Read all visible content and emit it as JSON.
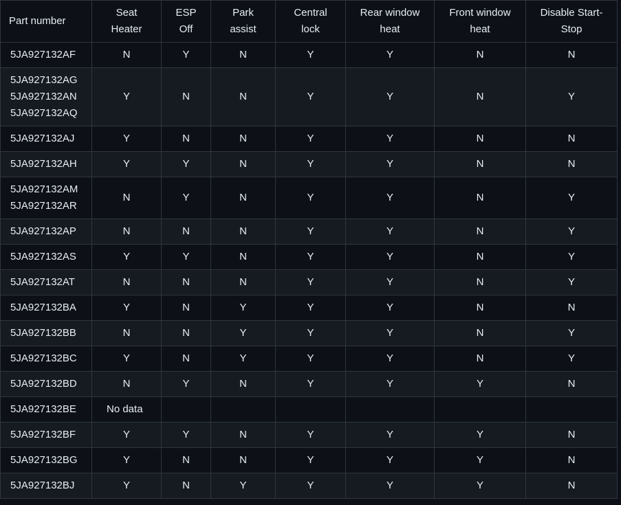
{
  "table": {
    "headers": [
      [
        "Part number"
      ],
      [
        "Seat",
        "Heater"
      ],
      [
        "ESP",
        "Off"
      ],
      [
        "Park",
        "assist"
      ],
      [
        "Central",
        "lock"
      ],
      [
        "Rear window",
        "heat"
      ],
      [
        "Front window",
        "heat"
      ],
      [
        "Disable Start-",
        "Stop"
      ]
    ],
    "rows": [
      {
        "parts": [
          "5JA927132AF"
        ],
        "values": [
          "N",
          "Y",
          "N",
          "Y",
          "Y",
          "N",
          "N"
        ]
      },
      {
        "parts": [
          "5JA927132AG",
          "5JA927132AN",
          "5JA927132AQ"
        ],
        "values": [
          "Y",
          "N",
          "N",
          "Y",
          "Y",
          "N",
          "Y"
        ]
      },
      {
        "parts": [
          "5JA927132AJ"
        ],
        "values": [
          "Y",
          "N",
          "N",
          "Y",
          "Y",
          "N",
          "N"
        ]
      },
      {
        "parts": [
          "5JA927132AH"
        ],
        "values": [
          "Y",
          "Y",
          "N",
          "Y",
          "Y",
          "N",
          "N"
        ]
      },
      {
        "parts": [
          "5JA927132AM",
          "5JA927132AR"
        ],
        "values": [
          "N",
          "Y",
          "N",
          "Y",
          "Y",
          "N",
          "Y"
        ]
      },
      {
        "parts": [
          "5JA927132AP"
        ],
        "values": [
          "N",
          "N",
          "N",
          "Y",
          "Y",
          "N",
          "Y"
        ]
      },
      {
        "parts": [
          "5JA927132AS"
        ],
        "values": [
          "Y",
          "Y",
          "N",
          "Y",
          "Y",
          "N",
          "Y"
        ]
      },
      {
        "parts": [
          "5JA927132AT"
        ],
        "values": [
          "N",
          "N",
          "N",
          "Y",
          "Y",
          "N",
          "Y"
        ]
      },
      {
        "parts": [
          "5JA927132BA"
        ],
        "values": [
          "Y",
          "N",
          "Y",
          "Y",
          "Y",
          "N",
          "N"
        ]
      },
      {
        "parts": [
          "5JA927132BB"
        ],
        "values": [
          "N",
          "N",
          "Y",
          "Y",
          "Y",
          "N",
          "Y"
        ]
      },
      {
        "parts": [
          "5JA927132BC"
        ],
        "values": [
          "Y",
          "N",
          "Y",
          "Y",
          "Y",
          "N",
          "Y"
        ]
      },
      {
        "parts": [
          "5JA927132BD"
        ],
        "values": [
          "N",
          "Y",
          "N",
          "Y",
          "Y",
          "Y",
          "N"
        ]
      },
      {
        "parts": [
          "5JA927132BE"
        ],
        "values": [
          "No data",
          "",
          "",
          "",
          "",
          "",
          ""
        ]
      },
      {
        "parts": [
          "5JA927132BF"
        ],
        "values": [
          "Y",
          "Y",
          "N",
          "Y",
          "Y",
          "Y",
          "N"
        ]
      },
      {
        "parts": [
          "5JA927132BG"
        ],
        "values": [
          "Y",
          "N",
          "N",
          "Y",
          "Y",
          "Y",
          "N"
        ]
      },
      {
        "parts": [
          "5JA927132BJ"
        ],
        "values": [
          "Y",
          "N",
          "Y",
          "Y",
          "Y",
          "Y",
          "N"
        ]
      }
    ]
  },
  "colors": {
    "background": "#0d1117",
    "row_alt": "#161b22",
    "border": "#30363d",
    "text": "#e6edf3"
  }
}
